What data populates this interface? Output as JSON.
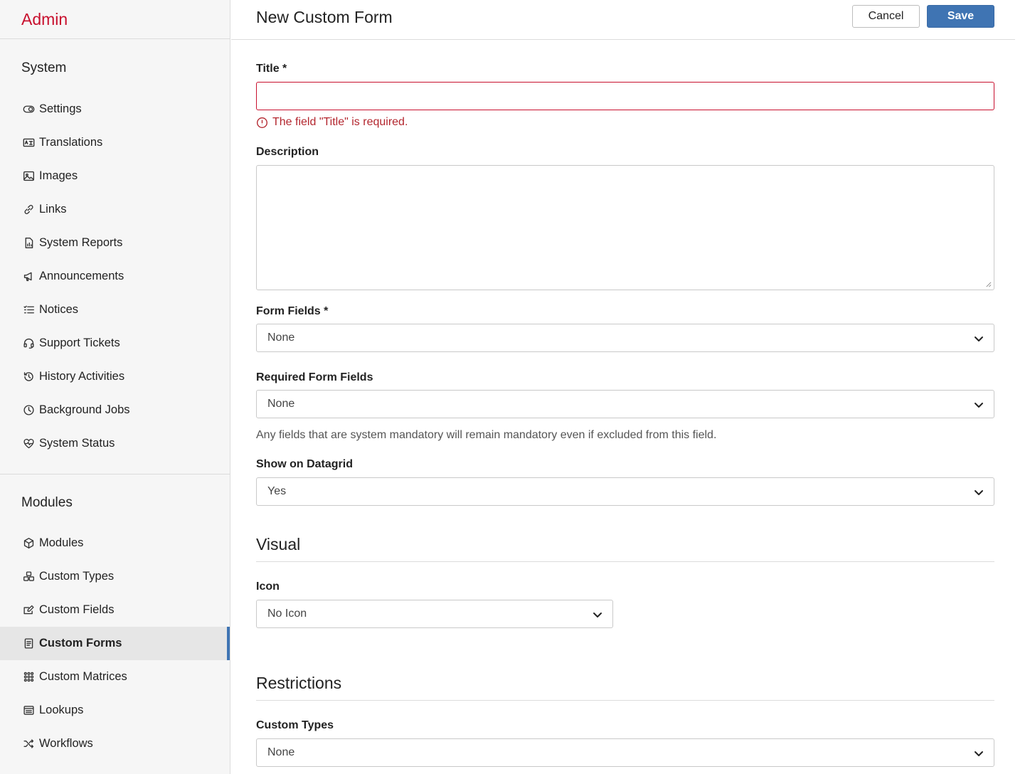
{
  "brand": "Admin",
  "sidebar": {
    "system_title": "System",
    "system_items": [
      {
        "label": "Settings",
        "icon": "toggle-icon"
      },
      {
        "label": "Translations",
        "icon": "translate-icon"
      },
      {
        "label": "Images",
        "icon": "image-icon"
      },
      {
        "label": "Links",
        "icon": "link-icon"
      },
      {
        "label": "System Reports",
        "icon": "report-icon"
      },
      {
        "label": "Announcements",
        "icon": "megaphone-icon"
      },
      {
        "label": "Notices",
        "icon": "list-icon"
      },
      {
        "label": "Support Tickets",
        "icon": "headset-icon"
      },
      {
        "label": "History Activities",
        "icon": "history-icon"
      },
      {
        "label": "Background Jobs",
        "icon": "clock-icon"
      },
      {
        "label": "System Status",
        "icon": "heartbeat-icon"
      }
    ],
    "modules_title": "Modules",
    "module_items": [
      {
        "label": "Modules",
        "icon": "box-icon"
      },
      {
        "label": "Custom Types",
        "icon": "boxes-icon"
      },
      {
        "label": "Custom Fields",
        "icon": "edit-field-icon"
      },
      {
        "label": "Custom Forms",
        "icon": "form-icon",
        "active": true
      },
      {
        "label": "Custom Matrices",
        "icon": "grid-icon"
      },
      {
        "label": "Lookups",
        "icon": "lookup-icon"
      },
      {
        "label": "Workflows",
        "icon": "shuffle-icon"
      }
    ]
  },
  "header": {
    "title": "New Custom Form",
    "cancel_label": "Cancel",
    "save_label": "Save"
  },
  "form": {
    "title_label": "Title *",
    "title_value": "",
    "title_error": "The field \"Title\" is required.",
    "description_label": "Description",
    "description_value": "",
    "form_fields_label": "Form Fields *",
    "form_fields_value": "None",
    "required_fields_label": "Required Form Fields",
    "required_fields_value": "None",
    "required_fields_help": "Any fields that are system mandatory will remain mandatory even if excluded from this field.",
    "show_datagrid_label": "Show on Datagrid",
    "show_datagrid_value": "Yes",
    "visual_heading": "Visual",
    "icon_label": "Icon",
    "icon_value": "No Icon",
    "restrictions_heading": "Restrictions",
    "custom_types_label": "Custom Types",
    "custom_types_value": "None"
  },
  "colors": {
    "brand": "#c8102e",
    "accent": "#3f74b3",
    "error": "#c8102e"
  }
}
